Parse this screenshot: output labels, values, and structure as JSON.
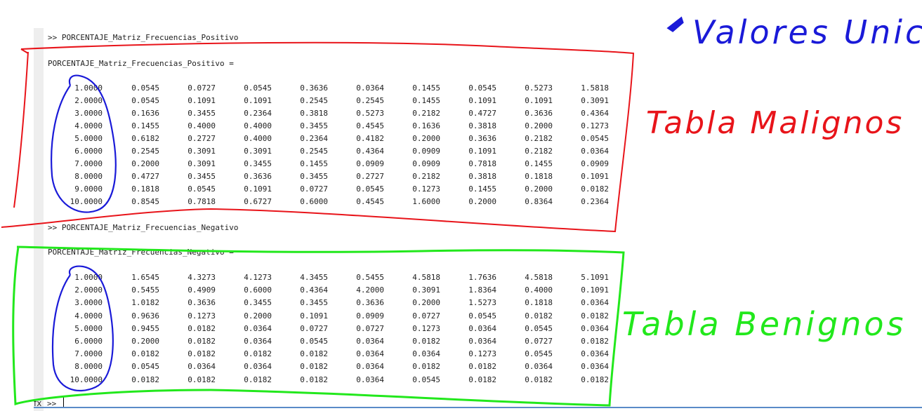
{
  "console": {
    "cmd_positive": ">> PORCENTAJE_Matriz_Frecuencias_Positivo",
    "header_positive": "PORCENTAJE_Matriz_Frecuencias_Positivo =",
    "cmd_negative": ">> PORCENTAJE_Matriz_Frecuencias_Negativo",
    "header_negative": "PORCENTAJE_Matriz_Frecuencias_Negativo =",
    "prompt": ">>",
    "positive_rows": [
      [
        "1.0000",
        "0.0545",
        "0.0727",
        "0.0545",
        "0.3636",
        "0.0364",
        "0.1455",
        "0.0545",
        "0.5273",
        "1.5818"
      ],
      [
        "2.0000",
        "0.0545",
        "0.1091",
        "0.1091",
        "0.2545",
        "0.2545",
        "0.1455",
        "0.1091",
        "0.1091",
        "0.3091"
      ],
      [
        "3.0000",
        "0.1636",
        "0.3455",
        "0.2364",
        "0.3818",
        "0.5273",
        "0.2182",
        "0.4727",
        "0.3636",
        "0.4364"
      ],
      [
        "4.0000",
        "0.1455",
        "0.4000",
        "0.4000",
        "0.3455",
        "0.4545",
        "0.1636",
        "0.3818",
        "0.2000",
        "0.1273"
      ],
      [
        "5.0000",
        "0.6182",
        "0.2727",
        "0.4000",
        "0.2364",
        "0.4182",
        "0.2000",
        "0.3636",
        "0.2182",
        "0.0545"
      ],
      [
        "6.0000",
        "0.2545",
        "0.3091",
        "0.3091",
        "0.2545",
        "0.4364",
        "0.0909",
        "0.1091",
        "0.2182",
        "0.0364"
      ],
      [
        "7.0000",
        "0.2000",
        "0.3091",
        "0.3455",
        "0.1455",
        "0.0909",
        "0.0909",
        "0.7818",
        "0.1455",
        "0.0909"
      ],
      [
        "8.0000",
        "0.4727",
        "0.3455",
        "0.3636",
        "0.3455",
        "0.2727",
        "0.2182",
        "0.3818",
        "0.1818",
        "0.1091"
      ],
      [
        "9.0000",
        "0.1818",
        "0.0545",
        "0.1091",
        "0.0727",
        "0.0545",
        "0.1273",
        "0.1455",
        "0.2000",
        "0.0182"
      ],
      [
        "10.0000",
        "0.8545",
        "0.7818",
        "0.6727",
        "0.6000",
        "0.4545",
        "1.6000",
        "0.2000",
        "0.8364",
        "0.2364"
      ]
    ],
    "negative_rows": [
      [
        "1.0000",
        "1.6545",
        "4.3273",
        "4.1273",
        "4.3455",
        "0.5455",
        "4.5818",
        "1.7636",
        "4.5818",
        "5.1091"
      ],
      [
        "2.0000",
        "0.5455",
        "0.4909",
        "0.6000",
        "0.4364",
        "4.2000",
        "0.3091",
        "1.8364",
        "0.4000",
        "0.1091"
      ],
      [
        "3.0000",
        "1.0182",
        "0.3636",
        "0.3455",
        "0.3455",
        "0.3636",
        "0.2000",
        "1.5273",
        "0.1818",
        "0.0364"
      ],
      [
        "4.0000",
        "0.9636",
        "0.1273",
        "0.2000",
        "0.1091",
        "0.0909",
        "0.0727",
        "0.0545",
        "0.0182",
        "0.0182"
      ],
      [
        "5.0000",
        "0.9455",
        "0.0182",
        "0.0364",
        "0.0727",
        "0.0727",
        "0.1273",
        "0.0364",
        "0.0545",
        "0.0364"
      ],
      [
        "6.0000",
        "0.2000",
        "0.0182",
        "0.0364",
        "0.0545",
        "0.0364",
        "0.0182",
        "0.0364",
        "0.0727",
        "0.0182"
      ],
      [
        "7.0000",
        "0.0182",
        "0.0182",
        "0.0182",
        "0.0182",
        "0.0364",
        "0.0364",
        "0.1273",
        "0.0545",
        "0.0364"
      ],
      [
        "8.0000",
        "0.0545",
        "0.0364",
        "0.0364",
        "0.0182",
        "0.0364",
        "0.0182",
        "0.0182",
        "0.0364",
        "0.0364"
      ],
      [
        "10.0000",
        "0.0182",
        "0.0182",
        "0.0182",
        "0.0182",
        "0.0364",
        "0.0545",
        "0.0182",
        "0.0182",
        "0.0182"
      ]
    ]
  },
  "annotations": {
    "valores_unicos": "Valores Unicos",
    "tabla_malignos": "Tabla Malignos",
    "tabla_benignos": "Tabla Benignos",
    "colors": {
      "red": "#e8141a",
      "green": "#22e81c",
      "blue": "#1a1ad8"
    }
  }
}
